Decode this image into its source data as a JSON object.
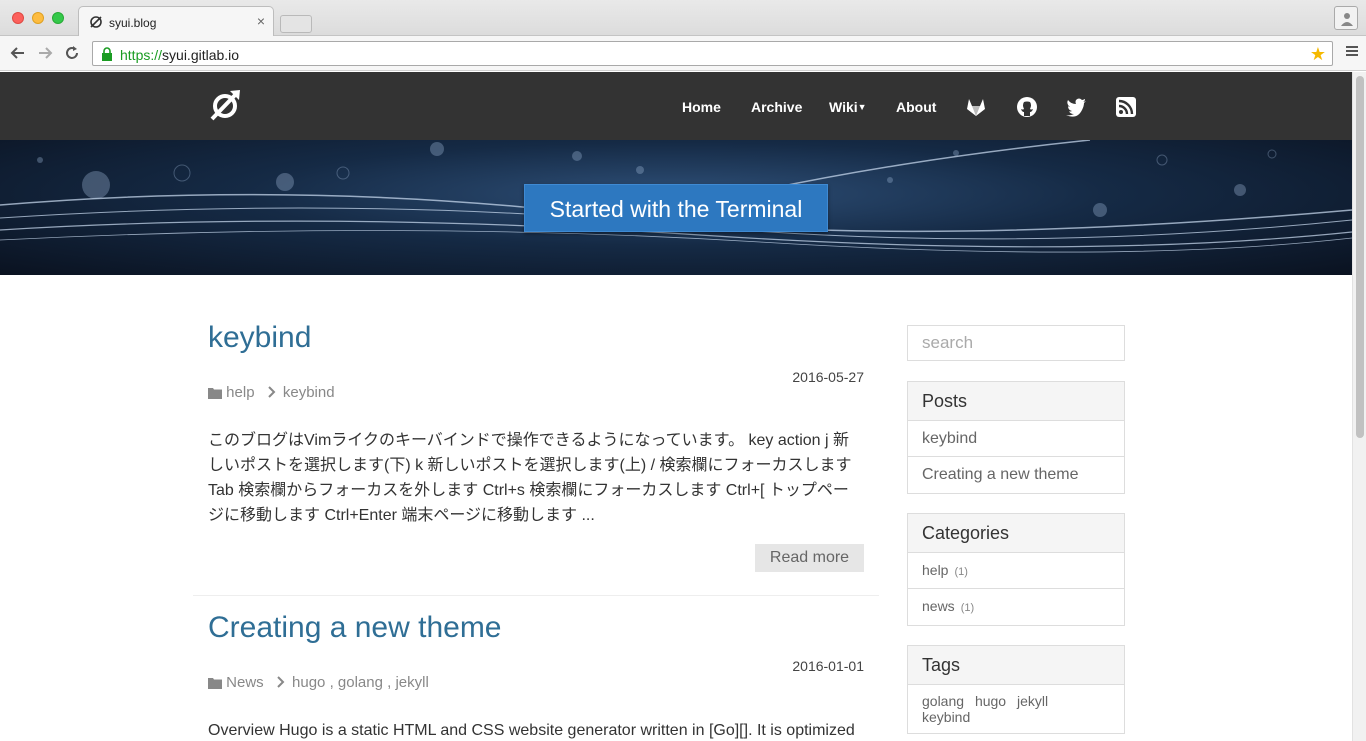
{
  "browser": {
    "tab_title": "syui.blog",
    "url_scheme": "https://",
    "url_host": "syui.gitlab.io"
  },
  "nav": {
    "links": [
      "Home",
      "Archive",
      "Wiki",
      "About"
    ],
    "icons": [
      "gitlab-icon",
      "github-icon",
      "twitter-icon",
      "rss-icon"
    ]
  },
  "hero": {
    "title": "Started with the Terminal"
  },
  "posts": [
    {
      "title": "keybind",
      "date": "2016-05-27",
      "category": "help",
      "tags": "keybind",
      "excerpt": "このブログはVimライクのキーバインドで操作できるようになっています。 key action j 新しいポストを選択します(下) k 新しいポストを選択します(上) / 検索欄にフォーカスします Tab 検索欄からフォーカスを外します Ctrl+s 検索欄にフォーカスします Ctrl+[ トップページに移動します Ctrl+Enter 端末ページに移動します ...",
      "read_more": "Read more"
    },
    {
      "title": "Creating a new theme",
      "date": "2016-01-01",
      "category": "News",
      "tags": "hugo , golang , jekyll",
      "excerpt": "Overview Hugo is a static HTML and CSS website generator written in [Go][]. It is optimized"
    }
  ],
  "sidebar": {
    "search_placeholder": "search",
    "posts": {
      "title": "Posts",
      "items": [
        "keybind",
        "Creating a new theme"
      ]
    },
    "categories": {
      "title": "Categories",
      "items": [
        {
          "name": "help",
          "count": "(1)"
        },
        {
          "name": "news",
          "count": "(1)"
        }
      ]
    },
    "tags": {
      "title": "Tags",
      "items": [
        "golang",
        "hugo",
        "jekyll",
        "keybind"
      ]
    }
  }
}
